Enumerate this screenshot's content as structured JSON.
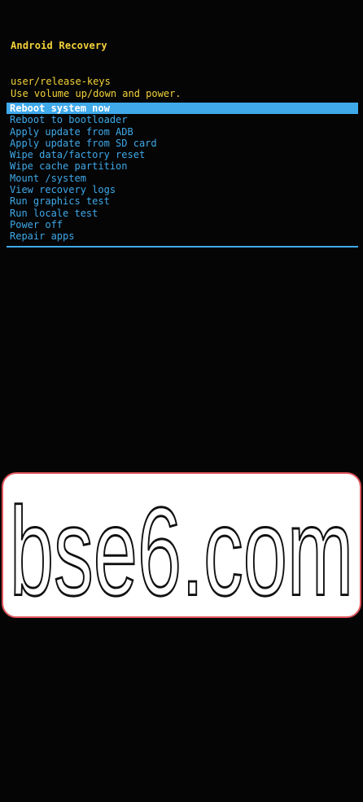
{
  "recovery": {
    "title": "Android Recovery",
    "build": "user/release-keys",
    "hint": "Use volume up/down and power.",
    "selected_index": 0,
    "menu_items": [
      "Reboot system now",
      "Reboot to bootloader",
      "Apply update from ADB",
      "Apply update from SD card",
      "Wipe data/factory reset",
      "Wipe cache partition",
      "Mount /system",
      "View recovery logs",
      "Run graphics test",
      "Run locale test",
      "Power off",
      "Repair apps"
    ]
  },
  "watermark": {
    "text": "bse6.com"
  },
  "colors": {
    "background": "#050505",
    "header_text": "#f5d23a",
    "menu_text": "#3fa9ea",
    "selected_bg": "#3fa9ea",
    "selected_text": "#ffffff",
    "watermark_border": "#e0555d"
  }
}
